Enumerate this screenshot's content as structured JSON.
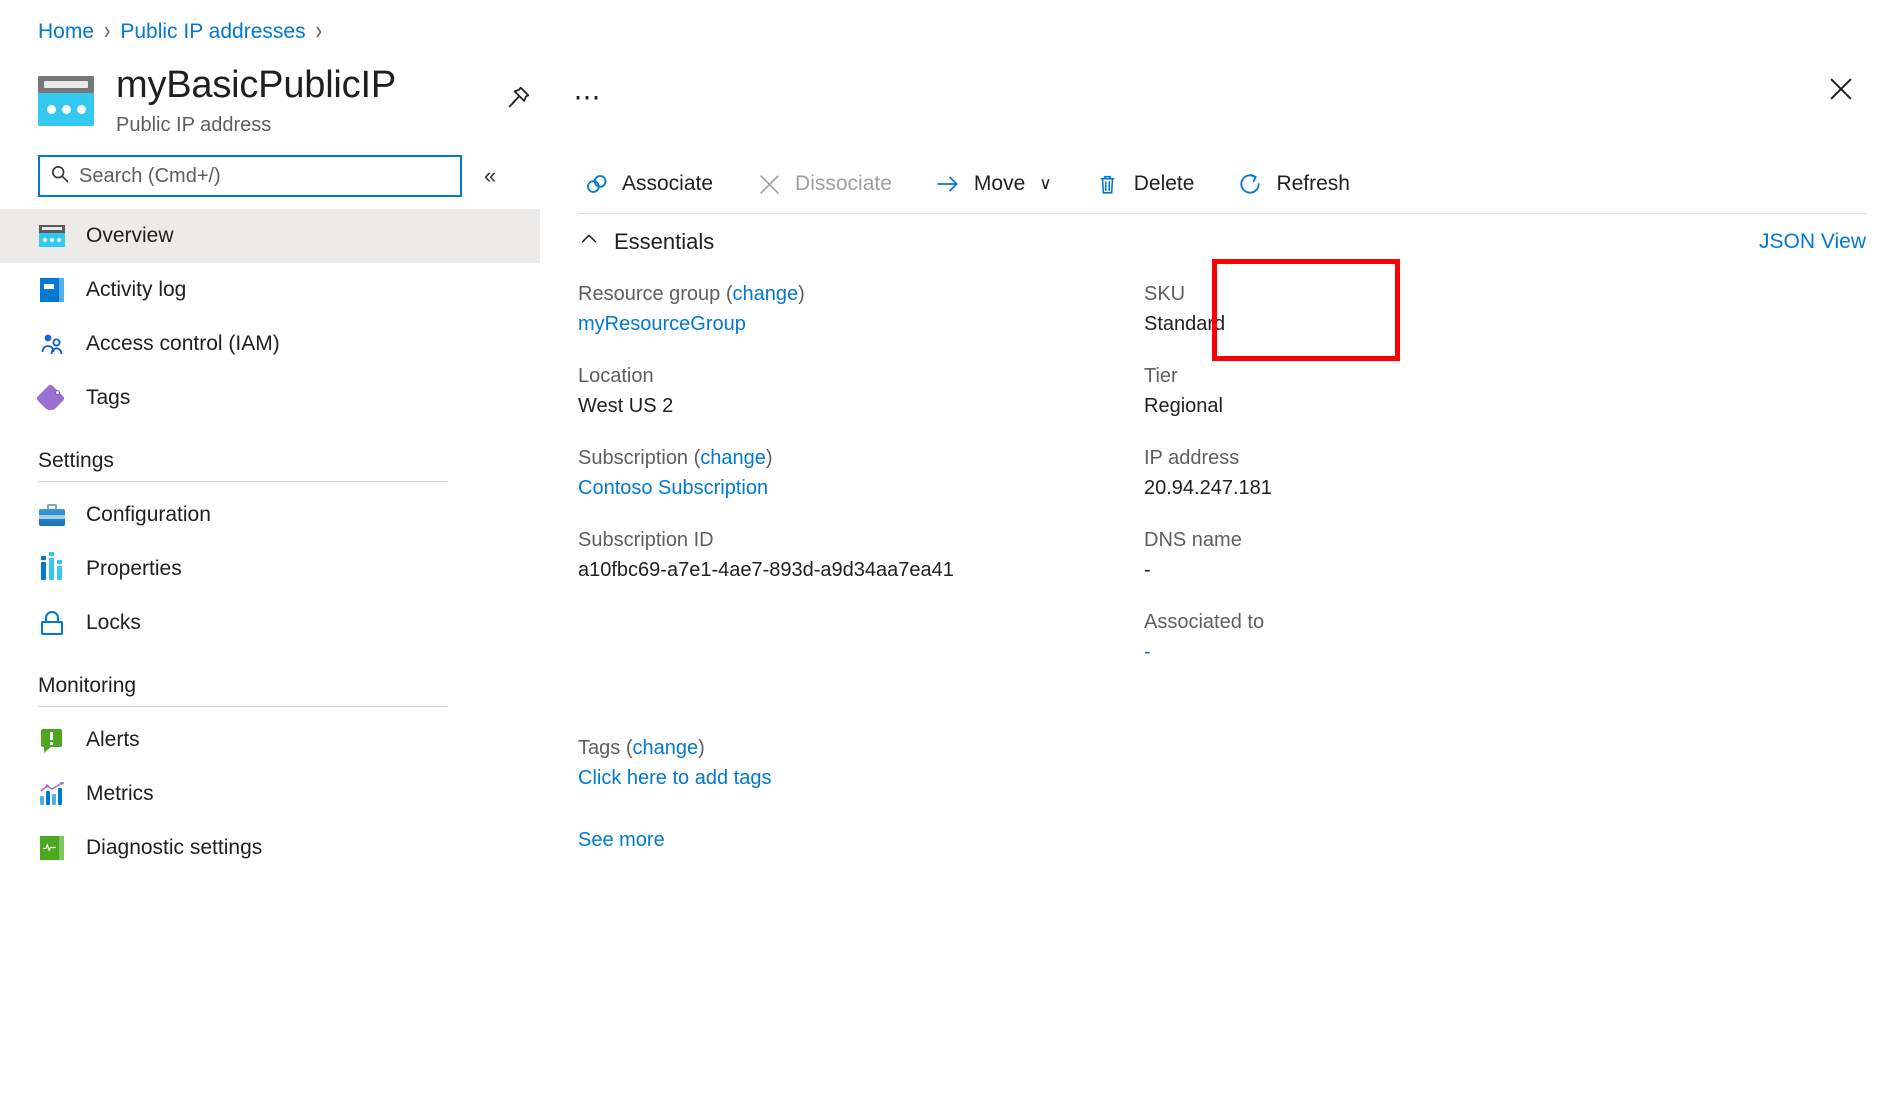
{
  "breadcrumb": {
    "items": [
      {
        "label": "Home"
      },
      {
        "label": "Public IP addresses"
      }
    ],
    "separator": "›"
  },
  "header": {
    "title": "myBasicPublicIP",
    "subtitle": "Public IP address",
    "pin_icon": "pin-icon",
    "more_icon": "ellipsis-icon",
    "close_icon": "close-icon"
  },
  "sidebar": {
    "search": {
      "placeholder": "Search (Cmd+/)",
      "icon": "search-icon"
    },
    "collapse_label": "«",
    "items": [
      {
        "label": "Overview",
        "icon": "public-ip-icon",
        "active": true
      },
      {
        "label": "Activity log",
        "icon": "activity-log-icon",
        "active": false
      },
      {
        "label": "Access control (IAM)",
        "icon": "access-control-icon",
        "active": false
      },
      {
        "label": "Tags",
        "icon": "tags-icon",
        "active": false
      }
    ],
    "groups": [
      {
        "title": "Settings",
        "items": [
          {
            "label": "Configuration",
            "icon": "configuration-icon"
          },
          {
            "label": "Properties",
            "icon": "properties-icon"
          },
          {
            "label": "Locks",
            "icon": "lock-icon"
          }
        ]
      },
      {
        "title": "Monitoring",
        "items": [
          {
            "label": "Alerts",
            "icon": "alerts-icon"
          },
          {
            "label": "Metrics",
            "icon": "metrics-icon"
          },
          {
            "label": "Diagnostic settings",
            "icon": "diagnostic-settings-icon"
          }
        ]
      }
    ]
  },
  "toolbar": {
    "associate": {
      "label": "Associate",
      "icon": "link-icon",
      "disabled": false
    },
    "dissociate": {
      "label": "Dissociate",
      "icon": "x-icon",
      "disabled": true
    },
    "move": {
      "label": "Move",
      "icon": "arrow-right-icon",
      "chevron": "∨",
      "disabled": false
    },
    "delete": {
      "label": "Delete",
      "icon": "trash-icon",
      "disabled": false
    },
    "refresh": {
      "label": "Refresh",
      "icon": "refresh-icon",
      "disabled": false
    }
  },
  "essentials": {
    "title": "Essentials",
    "collapse_icon": "chevron-up-icon",
    "json_view": "JSON View",
    "left": [
      {
        "label": "Resource group",
        "change": "change",
        "value": "myResourceGroup",
        "is_link": true
      },
      {
        "label": "Location",
        "value": "West US 2",
        "is_link": false
      },
      {
        "label": "Subscription",
        "change": "change",
        "value": "Contoso Subscription",
        "is_link": true
      },
      {
        "label": "Subscription ID",
        "value": "a10fbc69-a7e1-4ae7-893d-a9d34aa7ea41",
        "is_link": false
      }
    ],
    "right": [
      {
        "label": "SKU",
        "value": "Standard",
        "is_link": false,
        "highlighted": true
      },
      {
        "label": "Tier",
        "value": "Regional",
        "is_link": false
      },
      {
        "label": "IP address",
        "value": "20.94.247.181",
        "is_link": false
      },
      {
        "label": "DNS name",
        "value": "-",
        "is_link": false
      },
      {
        "label": "Associated to",
        "value": "-",
        "is_link": true
      }
    ]
  },
  "tags": {
    "label": "Tags",
    "change": "change",
    "add_link": "Click here to add tags"
  },
  "see_more": "See more",
  "colors": {
    "accent": "#0078d4",
    "highlight": "#ff0000",
    "muted": "#605e5c",
    "active_bg": "#edebe9"
  }
}
